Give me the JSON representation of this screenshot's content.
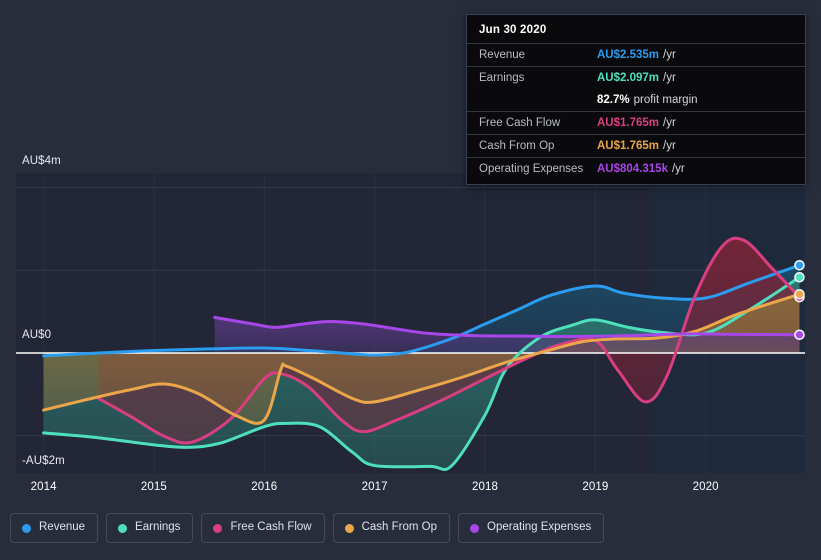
{
  "chart_data": {
    "type": "area",
    "title": "",
    "xlabel": "",
    "ylabel": "",
    "currency": "AU$",
    "x": [
      2014,
      2015,
      2016,
      2017,
      2018,
      2019,
      2020
    ],
    "xlim": [
      2013.75,
      2020.9
    ],
    "ylim": [
      -2.9,
      4.35
    ],
    "yticks": [
      4,
      2,
      0,
      -2
    ],
    "ytick_labels": [
      "AU$4m",
      "",
      "AU$0",
      "-AU$2m"
    ],
    "xtick_labels": [
      "2014",
      "2015",
      "2016",
      "2017",
      "2018",
      "2019",
      "2020"
    ],
    "grid": true,
    "legend_position": "bottom",
    "forecast_start_x": 2019.5,
    "series": [
      {
        "name": "Revenue",
        "color": "#2b9cf0",
        "fill": "#1d4d6b",
        "points": [
          [
            2014.0,
            -0.07
          ],
          [
            2014.5,
            0.0
          ],
          [
            2015.0,
            0.06
          ],
          [
            2015.5,
            0.1
          ],
          [
            2016.0,
            0.12
          ],
          [
            2016.4,
            0.06
          ],
          [
            2016.8,
            -0.02
          ],
          [
            2017.0,
            -0.05
          ],
          [
            2017.3,
            0.02
          ],
          [
            2017.7,
            0.35
          ],
          [
            2018.0,
            0.7
          ],
          [
            2018.3,
            1.05
          ],
          [
            2018.6,
            1.4
          ],
          [
            2019.0,
            1.62
          ],
          [
            2019.25,
            1.45
          ],
          [
            2019.6,
            1.33
          ],
          [
            2020.0,
            1.33
          ],
          [
            2020.4,
            1.7
          ],
          [
            2020.85,
            2.12
          ]
        ],
        "end_value": 2.535,
        "end_label": "AU$2.535m"
      },
      {
        "name": "Earnings",
        "color": "#4ee0bd",
        "fill": "#2d7a70",
        "points": [
          [
            2014.0,
            -1.93
          ],
          [
            2014.5,
            -2.05
          ],
          [
            2015.0,
            -2.22
          ],
          [
            2015.3,
            -2.28
          ],
          [
            2015.6,
            -2.18
          ],
          [
            2016.0,
            -1.78
          ],
          [
            2016.2,
            -1.7
          ],
          [
            2016.5,
            -1.78
          ],
          [
            2016.8,
            -2.4
          ],
          [
            2017.0,
            -2.72
          ],
          [
            2017.5,
            -2.74
          ],
          [
            2017.7,
            -2.72
          ],
          [
            2018.0,
            -1.5
          ],
          [
            2018.2,
            -0.35
          ],
          [
            2018.5,
            0.38
          ],
          [
            2018.8,
            0.68
          ],
          [
            2019.0,
            0.8
          ],
          [
            2019.3,
            0.62
          ],
          [
            2019.6,
            0.5
          ],
          [
            2020.0,
            0.48
          ],
          [
            2020.4,
            1.05
          ],
          [
            2020.85,
            1.83
          ]
        ],
        "end_value": 2.097,
        "end_label": "AU$2.097m"
      },
      {
        "name": "Free Cash Flow",
        "color": "#d83f80",
        "fill": "#7a2438",
        "points": [
          [
            2014.5,
            -1.1
          ],
          [
            2014.8,
            -1.55
          ],
          [
            2015.1,
            -2.02
          ],
          [
            2015.35,
            -2.15
          ],
          [
            2015.7,
            -1.58
          ],
          [
            2016.0,
            -0.62
          ],
          [
            2016.15,
            -0.5
          ],
          [
            2016.4,
            -0.82
          ],
          [
            2016.7,
            -1.62
          ],
          [
            2016.9,
            -1.9
          ],
          [
            2017.2,
            -1.62
          ],
          [
            2017.6,
            -1.15
          ],
          [
            2018.0,
            -0.62
          ],
          [
            2018.4,
            -0.1
          ],
          [
            2018.7,
            0.22
          ],
          [
            2019.0,
            0.3
          ],
          [
            2019.2,
            -0.4
          ],
          [
            2019.45,
            -1.18
          ],
          [
            2019.65,
            -0.55
          ],
          [
            2019.9,
            1.35
          ],
          [
            2020.15,
            2.58
          ],
          [
            2020.35,
            2.72
          ],
          [
            2020.6,
            2.05
          ],
          [
            2020.85,
            1.35
          ]
        ],
        "end_value": 1.765,
        "end_label": "AU$1.765m"
      },
      {
        "name": "Cash From Op",
        "color": "#eba64a",
        "fill": "#8a6a3a",
        "points": [
          [
            2014.0,
            -1.38
          ],
          [
            2014.4,
            -1.12
          ],
          [
            2014.8,
            -0.88
          ],
          [
            2015.1,
            -0.75
          ],
          [
            2015.4,
            -0.98
          ],
          [
            2015.75,
            -1.52
          ],
          [
            2016.0,
            -1.62
          ],
          [
            2016.15,
            -0.4
          ],
          [
            2016.2,
            -0.32
          ],
          [
            2016.45,
            -0.62
          ],
          [
            2016.8,
            -1.1
          ],
          [
            2017.0,
            -1.18
          ],
          [
            2017.4,
            -0.9
          ],
          [
            2017.8,
            -0.58
          ],
          [
            2018.2,
            -0.22
          ],
          [
            2018.6,
            0.08
          ],
          [
            2018.9,
            0.28
          ],
          [
            2019.2,
            0.34
          ],
          [
            2019.55,
            0.36
          ],
          [
            2019.9,
            0.52
          ],
          [
            2020.3,
            0.95
          ],
          [
            2020.85,
            1.42
          ]
        ],
        "end_value": 1.765,
        "end_label": "AU$1.765m"
      },
      {
        "name": "Operating Expenses",
        "color": "#a846e8",
        "fill": "#54397e",
        "points": [
          [
            2015.55,
            0.86
          ],
          [
            2015.9,
            0.7
          ],
          [
            2016.1,
            0.62
          ],
          [
            2016.35,
            0.7
          ],
          [
            2016.6,
            0.76
          ],
          [
            2016.9,
            0.7
          ],
          [
            2017.2,
            0.58
          ],
          [
            2017.5,
            0.47
          ],
          [
            2017.9,
            0.42
          ],
          [
            2018.3,
            0.41
          ],
          [
            2018.8,
            0.4
          ],
          [
            2019.3,
            0.42
          ],
          [
            2019.8,
            0.46
          ],
          [
            2020.3,
            0.45
          ],
          [
            2020.85,
            0.44
          ]
        ],
        "end_value": 0.804315,
        "end_label": "AU$804.315k"
      }
    ]
  },
  "tooltip": {
    "title": "Jun 30 2020",
    "rows": [
      {
        "key": "Revenue",
        "amount": "AU$2.535m",
        "unit": "/yr",
        "color": "#2b9cf0"
      },
      {
        "key": "Earnings",
        "amount": "AU$2.097m",
        "unit": "/yr",
        "color": "#4ee0bd"
      },
      {
        "key": "",
        "amount": "82.7%",
        "unit": "profit margin",
        "color": "#ffffff"
      },
      {
        "key": "Free Cash Flow",
        "amount": "AU$1.765m",
        "unit": "/yr",
        "color": "#d83f80"
      },
      {
        "key": "Cash From Op",
        "amount": "AU$1.765m",
        "unit": "/yr",
        "color": "#eba64a"
      },
      {
        "key": "Operating Expenses",
        "amount": "AU$804.315k",
        "unit": "/yr",
        "color": "#a846e8"
      }
    ]
  },
  "legend": {
    "items": [
      {
        "label": "Revenue",
        "color": "#2b9cf0"
      },
      {
        "label": "Earnings",
        "color": "#4ee0bd"
      },
      {
        "label": "Free Cash Flow",
        "color": "#d83f80"
      },
      {
        "label": "Cash From Op",
        "color": "#eba64a"
      },
      {
        "label": "Operating Expenses",
        "color": "#a846e8"
      }
    ]
  },
  "colors": {
    "background": "#282d3c",
    "plot_background": "#222636",
    "forecast_background": "#1e2a3c",
    "gridline": "#3d4254",
    "zero_line": "#ffffff",
    "tooltip_background": "#0a0a0c"
  }
}
